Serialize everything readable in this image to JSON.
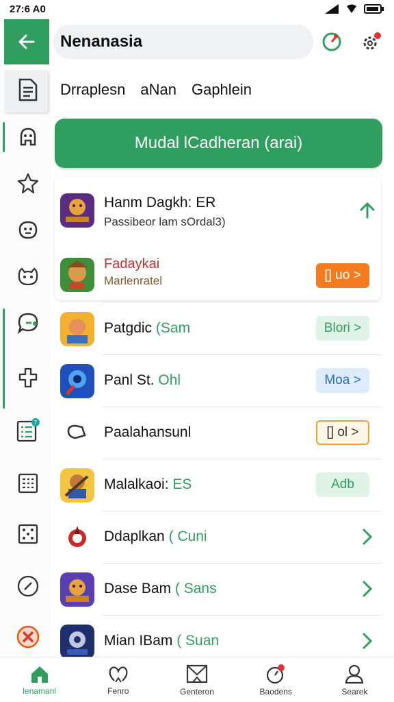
{
  "status_bar": {
    "time": "27:6 A0"
  },
  "app_bar": {
    "title": "Nenanasia",
    "back_icon": "arrow-left-icon",
    "icons": [
      "target-icon",
      "gear-icon"
    ]
  },
  "tabs": [
    "Drraplesn",
    "aNan",
    "Gaphlein"
  ],
  "primary_button": "Mudal lCadheran (arai)",
  "side_rail": [
    "document-icon",
    "robot-icon",
    "star-icon",
    "face-icon",
    "cat-icon",
    "chat-icon",
    "puzzle-icon",
    "list-badge-icon",
    "calculator-icon",
    "dice-icon",
    "compass-icon",
    "cancel-icon"
  ],
  "rows": [
    {
      "name": "Hanm Dagkh: ER",
      "sub": "Passibeor lam sOrdal3)",
      "control": "up-chevron"
    },
    {
      "name": "Fadaykai",
      "sub": "Marlenratel",
      "button": "[] uo >",
      "button_style": "orange-solid"
    },
    {
      "name": "Patgdic",
      "name_suffix": "(Sam",
      "button": "Blori >",
      "button_style": "green-soft"
    },
    {
      "name": "Panl St.",
      "name_suffix": "Ohl",
      "button": "Moa >",
      "button_style": "blue-soft"
    },
    {
      "name": "Paalahansunl",
      "button": "[] ol >",
      "button_style": "orange-outline"
    },
    {
      "name": "Malalkaoi:",
      "name_suffix": "ES",
      "button": "Adb",
      "button_style": "green-soft"
    },
    {
      "name": "Ddaplkan",
      "name_suffix": "( Cuni",
      "control": "chevron-right"
    },
    {
      "name": "Dase Bam",
      "name_suffix": "( Sans",
      "control": "chevron-right"
    },
    {
      "name": "Mian IBam",
      "name_suffix": "( Suan",
      "control": "chevron-right"
    }
  ],
  "bottom_nav": [
    {
      "label": "lenamanl",
      "icon": "home-icon"
    },
    {
      "label": "Fenro",
      "icon": "hearts-icon"
    },
    {
      "label": "Genteron",
      "icon": "mail-icon"
    },
    {
      "label": "Baodens",
      "icon": "alarm-icon"
    },
    {
      "label": "Searek",
      "icon": "user-icon"
    }
  ],
  "colors": {
    "accent": "#2f9e5e",
    "orange": "#f47b20",
    "green_soft": "#dff3e6",
    "blue_soft": "#dcecfb"
  }
}
